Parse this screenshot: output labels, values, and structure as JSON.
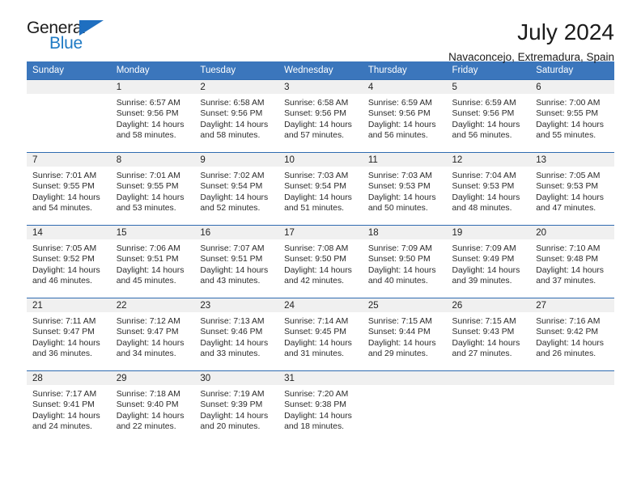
{
  "brand": {
    "name_dark": "General",
    "name_blue": "Blue",
    "triangle_icon": "triangle-icon",
    "accent_color": "#1f7ac4"
  },
  "header": {
    "title": "July 2024",
    "subtitle": "Navaconcejo, Extremadura, Spain"
  },
  "theme": {
    "header_row_color": "#3b76bc",
    "week_divider_color": "#2f6bb0",
    "daynum_band_color": "#f0f0f0",
    "text_color": "#2b2b2b"
  },
  "weekdays": [
    "Sunday",
    "Monday",
    "Tuesday",
    "Wednesday",
    "Thursday",
    "Friday",
    "Saturday"
  ],
  "weeks": [
    [
      {
        "day": "",
        "empty": true,
        "lines": []
      },
      {
        "day": "1",
        "lines": [
          "Sunrise: 6:57 AM",
          "Sunset: 9:56 PM",
          "Daylight: 14 hours",
          "and 58 minutes."
        ]
      },
      {
        "day": "2",
        "lines": [
          "Sunrise: 6:58 AM",
          "Sunset: 9:56 PM",
          "Daylight: 14 hours",
          "and 58 minutes."
        ]
      },
      {
        "day": "3",
        "lines": [
          "Sunrise: 6:58 AM",
          "Sunset: 9:56 PM",
          "Daylight: 14 hours",
          "and 57 minutes."
        ]
      },
      {
        "day": "4",
        "lines": [
          "Sunrise: 6:59 AM",
          "Sunset: 9:56 PM",
          "Daylight: 14 hours",
          "and 56 minutes."
        ]
      },
      {
        "day": "5",
        "lines": [
          "Sunrise: 6:59 AM",
          "Sunset: 9:56 PM",
          "Daylight: 14 hours",
          "and 56 minutes."
        ]
      },
      {
        "day": "6",
        "lines": [
          "Sunrise: 7:00 AM",
          "Sunset: 9:55 PM",
          "Daylight: 14 hours",
          "and 55 minutes."
        ]
      }
    ],
    [
      {
        "day": "7",
        "lines": [
          "Sunrise: 7:01 AM",
          "Sunset: 9:55 PM",
          "Daylight: 14 hours",
          "and 54 minutes."
        ]
      },
      {
        "day": "8",
        "lines": [
          "Sunrise: 7:01 AM",
          "Sunset: 9:55 PM",
          "Daylight: 14 hours",
          "and 53 minutes."
        ]
      },
      {
        "day": "9",
        "lines": [
          "Sunrise: 7:02 AM",
          "Sunset: 9:54 PM",
          "Daylight: 14 hours",
          "and 52 minutes."
        ]
      },
      {
        "day": "10",
        "lines": [
          "Sunrise: 7:03 AM",
          "Sunset: 9:54 PM",
          "Daylight: 14 hours",
          "and 51 minutes."
        ]
      },
      {
        "day": "11",
        "lines": [
          "Sunrise: 7:03 AM",
          "Sunset: 9:53 PM",
          "Daylight: 14 hours",
          "and 50 minutes."
        ]
      },
      {
        "day": "12",
        "lines": [
          "Sunrise: 7:04 AM",
          "Sunset: 9:53 PM",
          "Daylight: 14 hours",
          "and 48 minutes."
        ]
      },
      {
        "day": "13",
        "lines": [
          "Sunrise: 7:05 AM",
          "Sunset: 9:53 PM",
          "Daylight: 14 hours",
          "and 47 minutes."
        ]
      }
    ],
    [
      {
        "day": "14",
        "lines": [
          "Sunrise: 7:05 AM",
          "Sunset: 9:52 PM",
          "Daylight: 14 hours",
          "and 46 minutes."
        ]
      },
      {
        "day": "15",
        "lines": [
          "Sunrise: 7:06 AM",
          "Sunset: 9:51 PM",
          "Daylight: 14 hours",
          "and 45 minutes."
        ]
      },
      {
        "day": "16",
        "lines": [
          "Sunrise: 7:07 AM",
          "Sunset: 9:51 PM",
          "Daylight: 14 hours",
          "and 43 minutes."
        ]
      },
      {
        "day": "17",
        "lines": [
          "Sunrise: 7:08 AM",
          "Sunset: 9:50 PM",
          "Daylight: 14 hours",
          "and 42 minutes."
        ]
      },
      {
        "day": "18",
        "lines": [
          "Sunrise: 7:09 AM",
          "Sunset: 9:50 PM",
          "Daylight: 14 hours",
          "and 40 minutes."
        ]
      },
      {
        "day": "19",
        "lines": [
          "Sunrise: 7:09 AM",
          "Sunset: 9:49 PM",
          "Daylight: 14 hours",
          "and 39 minutes."
        ]
      },
      {
        "day": "20",
        "lines": [
          "Sunrise: 7:10 AM",
          "Sunset: 9:48 PM",
          "Daylight: 14 hours",
          "and 37 minutes."
        ]
      }
    ],
    [
      {
        "day": "21",
        "lines": [
          "Sunrise: 7:11 AM",
          "Sunset: 9:47 PM",
          "Daylight: 14 hours",
          "and 36 minutes."
        ]
      },
      {
        "day": "22",
        "lines": [
          "Sunrise: 7:12 AM",
          "Sunset: 9:47 PM",
          "Daylight: 14 hours",
          "and 34 minutes."
        ]
      },
      {
        "day": "23",
        "lines": [
          "Sunrise: 7:13 AM",
          "Sunset: 9:46 PM",
          "Daylight: 14 hours",
          "and 33 minutes."
        ]
      },
      {
        "day": "24",
        "lines": [
          "Sunrise: 7:14 AM",
          "Sunset: 9:45 PM",
          "Daylight: 14 hours",
          "and 31 minutes."
        ]
      },
      {
        "day": "25",
        "lines": [
          "Sunrise: 7:15 AM",
          "Sunset: 9:44 PM",
          "Daylight: 14 hours",
          "and 29 minutes."
        ]
      },
      {
        "day": "26",
        "lines": [
          "Sunrise: 7:15 AM",
          "Sunset: 9:43 PM",
          "Daylight: 14 hours",
          "and 27 minutes."
        ]
      },
      {
        "day": "27",
        "lines": [
          "Sunrise: 7:16 AM",
          "Sunset: 9:42 PM",
          "Daylight: 14 hours",
          "and 26 minutes."
        ]
      }
    ],
    [
      {
        "day": "28",
        "lines": [
          "Sunrise: 7:17 AM",
          "Sunset: 9:41 PM",
          "Daylight: 14 hours",
          "and 24 minutes."
        ]
      },
      {
        "day": "29",
        "lines": [
          "Sunrise: 7:18 AM",
          "Sunset: 9:40 PM",
          "Daylight: 14 hours",
          "and 22 minutes."
        ]
      },
      {
        "day": "30",
        "lines": [
          "Sunrise: 7:19 AM",
          "Sunset: 9:39 PM",
          "Daylight: 14 hours",
          "and 20 minutes."
        ]
      },
      {
        "day": "31",
        "lines": [
          "Sunrise: 7:20 AM",
          "Sunset: 9:38 PM",
          "Daylight: 14 hours",
          "and 18 minutes."
        ]
      },
      {
        "day": "",
        "empty": true,
        "lines": []
      },
      {
        "day": "",
        "empty": true,
        "lines": []
      },
      {
        "day": "",
        "empty": true,
        "lines": []
      }
    ]
  ]
}
